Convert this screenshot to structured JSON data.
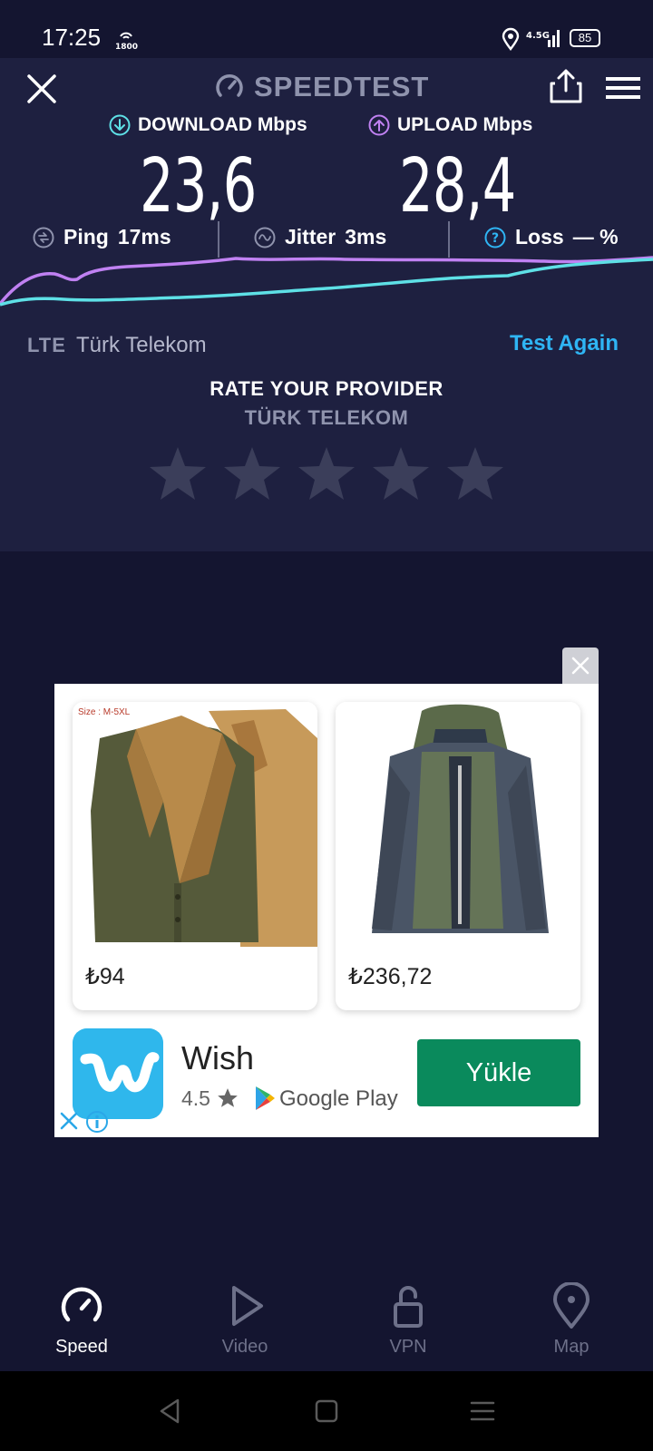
{
  "status_bar": {
    "time": "17:25",
    "net_type": "4.5G",
    "battery": "85"
  },
  "header": {
    "title": "SPEEDTEST"
  },
  "results": {
    "download_label": "DOWNLOAD Mbps",
    "download_value": "23,6",
    "upload_label": "UPLOAD Mbps",
    "upload_value": "28,4",
    "ping_label": "Ping",
    "ping_value": "17ms",
    "jitter_label": "Jitter",
    "jitter_value": "3ms",
    "loss_label": "Loss",
    "loss_value": "— %"
  },
  "provider": {
    "connection": "LTE",
    "name": "Türk Telekom",
    "test_again": "Test Again"
  },
  "rating": {
    "title": "RATE YOUR PROVIDER",
    "provider": "TÜRK TELEKOM",
    "stars_total": 5,
    "stars_selected": 0
  },
  "ad": {
    "products": [
      {
        "price": "₺94",
        "size_tag": "Size : M-5XL"
      },
      {
        "price": "₺236,72"
      }
    ],
    "app_name": "Wish",
    "rating": "4.5",
    "store": "Google Play",
    "install_label": "Yükle"
  },
  "bottom_nav": {
    "items": [
      {
        "label": "Speed",
        "icon": "speedometer-icon",
        "active": true
      },
      {
        "label": "Video",
        "icon": "play-icon",
        "active": false
      },
      {
        "label": "VPN",
        "icon": "lock-open-icon",
        "active": false
      },
      {
        "label": "Map",
        "icon": "map-pin-icon",
        "active": false
      }
    ]
  },
  "colors": {
    "download_accent": "#5ee0e6",
    "upload_accent": "#c081f2",
    "link_blue": "#2fb5f4",
    "install_green": "#0a8a5c",
    "panel_bg": "#1e2040",
    "page_bg": "#141530"
  }
}
